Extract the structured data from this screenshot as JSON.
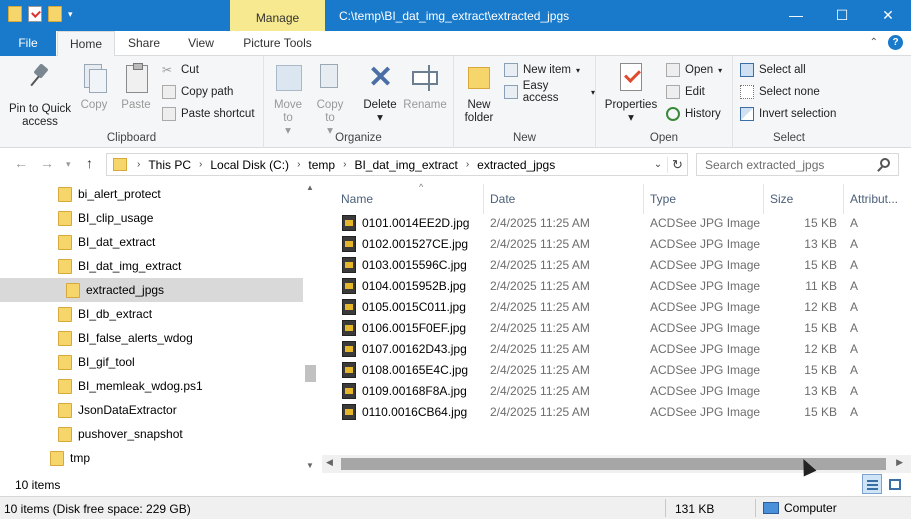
{
  "window": {
    "title": "C:\\temp\\BI_dat_img_extract\\extracted_jpgs",
    "manage_tab": "Manage",
    "minimize": "—",
    "maximize": "☐",
    "close": "✕"
  },
  "ribbon_tabs": {
    "file": "File",
    "home": "Home",
    "share": "Share",
    "view": "View",
    "picture_tools": "Picture Tools"
  },
  "ribbon": {
    "clipboard": {
      "label": "Clipboard",
      "pin": "Pin to Quick access",
      "copy": "Copy",
      "paste": "Paste",
      "cut": "Cut",
      "copy_path": "Copy path",
      "paste_shortcut": "Paste shortcut"
    },
    "organize": {
      "label": "Organize",
      "move_to": "Move to",
      "copy_to": "Copy to",
      "delete": "Delete",
      "rename": "Rename"
    },
    "new": {
      "label": "New",
      "new_folder": "New folder",
      "new_item": "New item",
      "easy_access": "Easy access"
    },
    "open": {
      "label": "Open",
      "properties": "Properties",
      "open": "Open",
      "edit": "Edit",
      "history": "History"
    },
    "select": {
      "label": "Select",
      "select_all": "Select all",
      "select_none": "Select none",
      "invert": "Invert selection"
    }
  },
  "address": {
    "crumbs": [
      "This PC",
      "Local Disk (C:)",
      "temp",
      "BI_dat_img_extract",
      "extracted_jpgs"
    ],
    "search_placeholder": "Search extracted_jpgs"
  },
  "tree": [
    {
      "label": "bi_alert_protect"
    },
    {
      "label": "BI_clip_usage"
    },
    {
      "label": "BI_dat_extract"
    },
    {
      "label": "BI_dat_img_extract"
    },
    {
      "label": "extracted_jpgs"
    },
    {
      "label": "BI_db_extract"
    },
    {
      "label": "BI_false_alerts_wdog"
    },
    {
      "label": "BI_gif_tool"
    },
    {
      "label": "BI_memleak_wdog.ps1"
    },
    {
      "label": "JsonDataExtractor"
    },
    {
      "label": "pushover_snapshot"
    },
    {
      "label": "tmp"
    }
  ],
  "columns": {
    "name": "Name",
    "date": "Date",
    "type": "Type",
    "size": "Size",
    "attributes": "Attribut..."
  },
  "files": [
    {
      "name": "0101.0014EE2D.jpg",
      "date": "2/4/2025 11:25 AM",
      "type": "ACDSee JPG Image",
      "size": "15 KB",
      "attr": "A"
    },
    {
      "name": "0102.001527CE.jpg",
      "date": "2/4/2025 11:25 AM",
      "type": "ACDSee JPG Image",
      "size": "13 KB",
      "attr": "A"
    },
    {
      "name": "0103.0015596C.jpg",
      "date": "2/4/2025 11:25 AM",
      "type": "ACDSee JPG Image",
      "size": "15 KB",
      "attr": "A"
    },
    {
      "name": "0104.0015952B.jpg",
      "date": "2/4/2025 11:25 AM",
      "type": "ACDSee JPG Image",
      "size": "11 KB",
      "attr": "A"
    },
    {
      "name": "0105.0015C011.jpg",
      "date": "2/4/2025 11:25 AM",
      "type": "ACDSee JPG Image",
      "size": "12 KB",
      "attr": "A"
    },
    {
      "name": "0106.0015F0EF.jpg",
      "date": "2/4/2025 11:25 AM",
      "type": "ACDSee JPG Image",
      "size": "15 KB",
      "attr": "A"
    },
    {
      "name": "0107.00162D43.jpg",
      "date": "2/4/2025 11:25 AM",
      "type": "ACDSee JPG Image",
      "size": "12 KB",
      "attr": "A"
    },
    {
      "name": "0108.00165E4C.jpg",
      "date": "2/4/2025 11:25 AM",
      "type": "ACDSee JPG Image",
      "size": "15 KB",
      "attr": "A"
    },
    {
      "name": "0109.00168F8A.jpg",
      "date": "2/4/2025 11:25 AM",
      "type": "ACDSee JPG Image",
      "size": "13 KB",
      "attr": "A"
    },
    {
      "name": "0110.0016CB64.jpg",
      "date": "2/4/2025 11:25 AM",
      "type": "ACDSee JPG Image",
      "size": "15 KB",
      "attr": "A"
    }
  ],
  "status": {
    "item_count": "10 items",
    "bottom_left": "10 items (Disk free space: 229 GB)",
    "bottom_size": "131 KB",
    "bottom_location": "Computer"
  }
}
